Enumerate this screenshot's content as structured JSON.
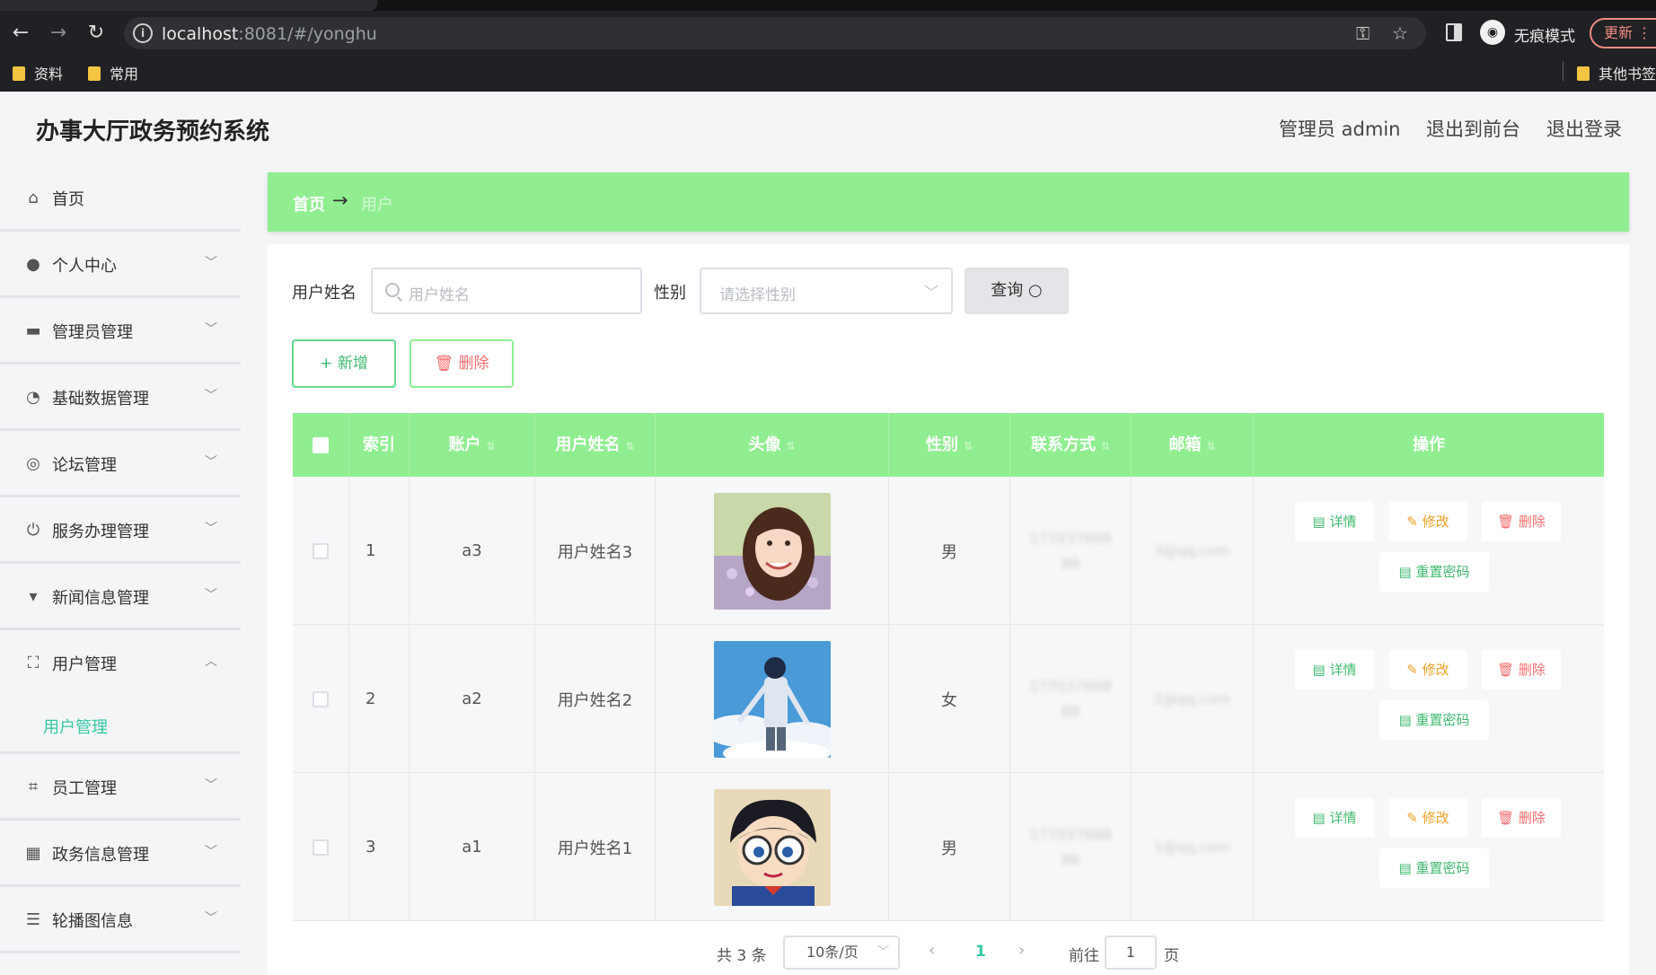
{
  "browser": {
    "url_host": "localhost",
    "url_rest": ":8081/#/yonghu",
    "incognito_label": "无痕模式",
    "update_label": "更新",
    "bookmarks": [
      "资料",
      "常用"
    ],
    "other_bookmarks": "其他书签"
  },
  "header": {
    "title": "办事大厅政务预约系统",
    "admin_label": "管理员 admin",
    "to_front": "退出到前台",
    "logout": "退出登录"
  },
  "sidebar": {
    "items": [
      {
        "label": "首页",
        "icon": "home-icon"
      },
      {
        "label": "个人中心",
        "icon": "user-icon"
      },
      {
        "label": "管理员管理",
        "icon": "monitor-icon"
      },
      {
        "label": "基础数据管理",
        "icon": "dashboard-icon"
      },
      {
        "label": "论坛管理",
        "icon": "forum-icon"
      },
      {
        "label": "服务办理管理",
        "icon": "power-icon"
      },
      {
        "label": "新闻信息管理",
        "icon": "news-icon"
      },
      {
        "label": "用户管理",
        "icon": "fullscreen-icon"
      },
      {
        "label": "员工管理",
        "icon": "crop-icon"
      },
      {
        "label": "政务信息管理",
        "icon": "building-icon"
      },
      {
        "label": "轮播图信息",
        "icon": "list-icon"
      }
    ],
    "submenu_active": "用户管理"
  },
  "breadcrumb": {
    "home": "首页",
    "arrow": "→",
    "current": "用户"
  },
  "search": {
    "name_label": "用户姓名",
    "name_placeholder": "用户姓名",
    "gender_label": "性别",
    "gender_placeholder": "请选择性别",
    "query_button": "查询"
  },
  "actions": {
    "add": "+ 新增",
    "delete": "删除"
  },
  "table": {
    "columns": [
      "索引",
      "账户",
      "用户姓名",
      "头像",
      "性别",
      "联系方式",
      "邮箱",
      "操作"
    ],
    "rows": [
      {
        "index": "1",
        "account": "a3",
        "name": "用户姓名3",
        "gender": "男",
        "phone": "17703788888",
        "email": "3@qq.com"
      },
      {
        "index": "2",
        "account": "a2",
        "name": "用户姓名2",
        "gender": "女",
        "phone": "17703788888",
        "email": "2@qq.com"
      },
      {
        "index": "3",
        "account": "a1",
        "name": "用户姓名1",
        "gender": "男",
        "phone": "17703788888",
        "email": "1@qq.com"
      }
    ],
    "ops": {
      "detail": "详情",
      "edit": "修改",
      "delete": "删除",
      "reset": "重置密码"
    }
  },
  "pagination": {
    "total": "共 3 条",
    "page_size": "10条/页",
    "current_page": "1",
    "goto_label": "前往",
    "goto_value": "1",
    "page_suffix": "页"
  },
  "colors": {
    "accent": "#90ee90",
    "active_text": "#35c8a3"
  }
}
